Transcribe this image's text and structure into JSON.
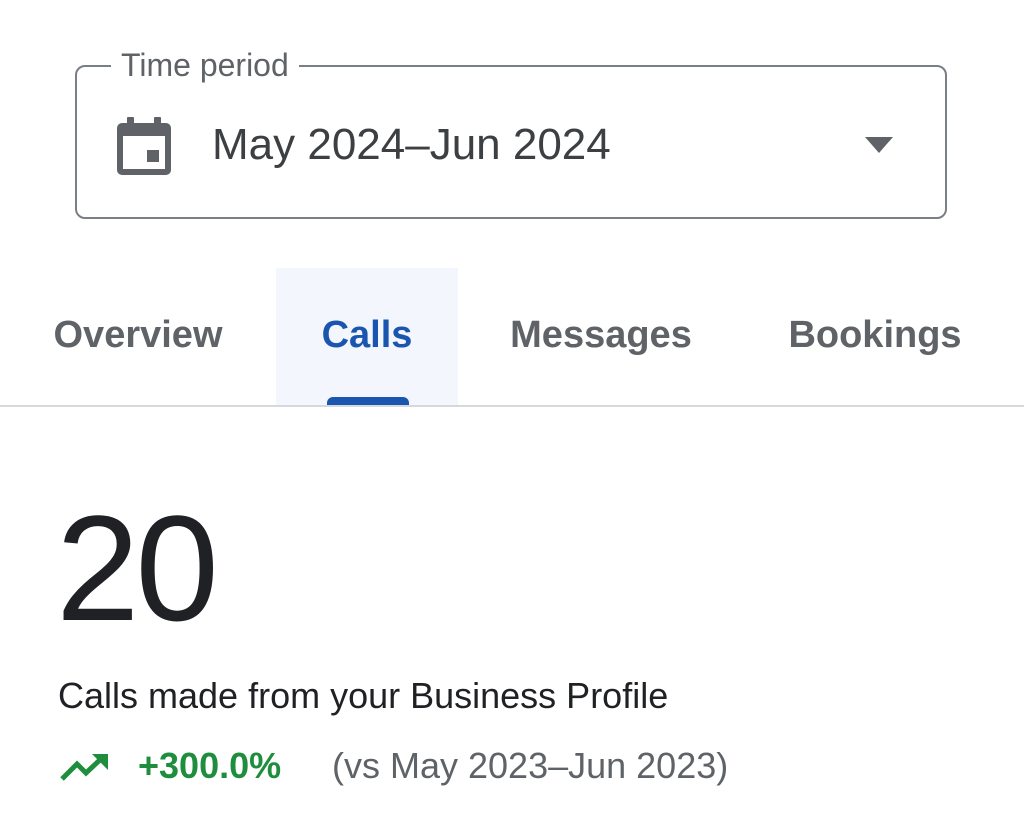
{
  "time_period": {
    "label": "Time period",
    "value": "May 2024–Jun 2024",
    "icon": "calendar-icon",
    "dropdown_icon": "arrow-drop-down-icon"
  },
  "tabs": [
    {
      "label": "Overview",
      "selected": false
    },
    {
      "label": "Calls",
      "selected": true
    },
    {
      "label": "Messages",
      "selected": false
    },
    {
      "label": "Bookings",
      "selected": false
    }
  ],
  "metric": {
    "value": "20",
    "description": "Calls made from your Business Profile",
    "change": "+300.0%",
    "comparison": "(vs May 2023–Jun 2023)",
    "trend_icon": "trending-up-icon"
  },
  "colors": {
    "accent": "#1a56b0",
    "positive": "#1e8e3e",
    "selected_tab_bg": "#f3f6fc"
  }
}
